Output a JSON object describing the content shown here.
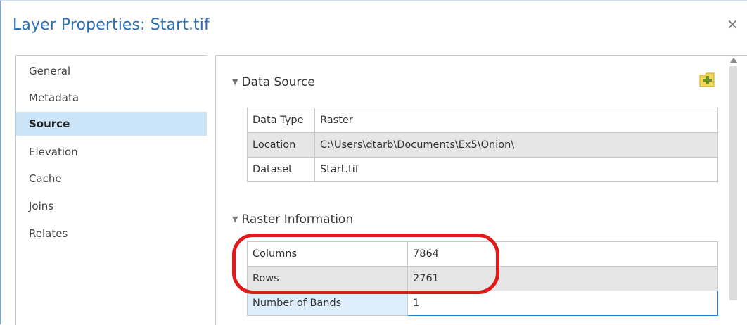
{
  "window": {
    "title": "Layer Properties: Start.tif",
    "close_glyph": "×"
  },
  "sidebar": {
    "items": [
      {
        "label": "General"
      },
      {
        "label": "Metadata"
      },
      {
        "label": "Source",
        "active": true
      },
      {
        "label": "Elevation"
      },
      {
        "label": "Cache"
      },
      {
        "label": "Joins"
      },
      {
        "label": "Relates"
      }
    ]
  },
  "data_source": {
    "heading": "Data Source",
    "rows": [
      {
        "label": "Data Type",
        "value": "Raster"
      },
      {
        "label": "Location",
        "value": "C:\\Users\\dtarb\\Documents\\Ex5\\Onion\\"
      },
      {
        "label": "Dataset",
        "value": "Start.tif"
      }
    ]
  },
  "raster_info": {
    "heading": "Raster Information",
    "rows": [
      {
        "label": "Columns",
        "value": "7864"
      },
      {
        "label": "Rows",
        "value": "2761"
      },
      {
        "label": "Number of Bands",
        "value": "1"
      }
    ]
  },
  "colors": {
    "title": "#2a6fb3",
    "selected_item": "#cce4f7",
    "annotation": "#e01b1b"
  }
}
